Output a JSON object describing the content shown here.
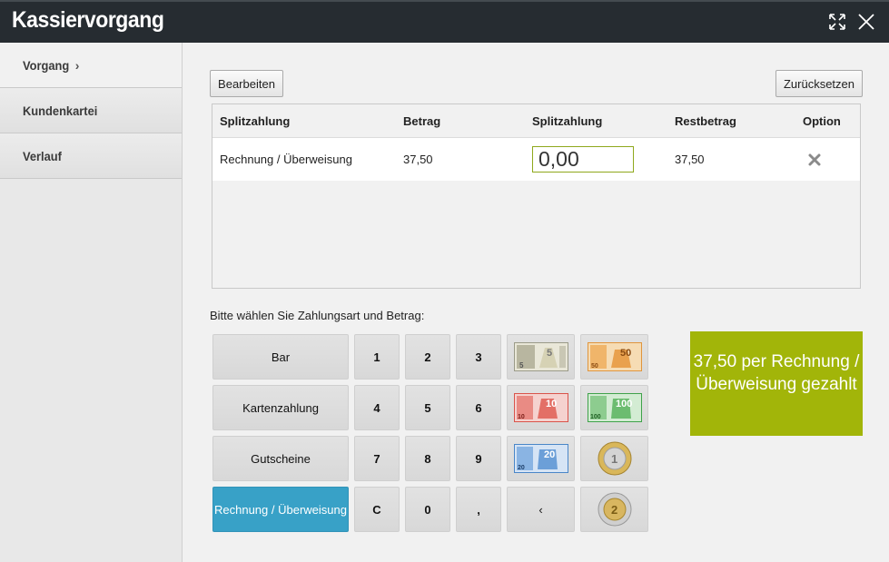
{
  "window": {
    "title": "Kassiervorgang"
  },
  "sidebar": {
    "items": [
      {
        "label": "Vorgang",
        "active": true,
        "chevron": "›"
      },
      {
        "label": "Kundenkartei",
        "active": false
      },
      {
        "label": "Verlauf",
        "active": false
      }
    ]
  },
  "toolbar": {
    "edit_label": "Bearbeiten",
    "reset_label": "Zurücksetzen"
  },
  "table": {
    "headers": [
      "Splitzahlung",
      "Betrag",
      "Splitzahlung",
      "Restbetrag",
      "Option"
    ],
    "rows": [
      {
        "method": "Rechnung / Überweisung",
        "amount": "37,50",
        "split_value": "0,00",
        "rest": "37,50",
        "option_icon": "close-x-icon"
      }
    ]
  },
  "instruction": "Bitte wählen Sie Zahlungsart und Betrag:",
  "payment_types": [
    "Bar",
    "Kartenzahlung",
    "Gutscheine",
    "Rechnung / Überweisung"
  ],
  "active_payment_type": "Rechnung / Überweisung",
  "keypad": [
    [
      "1",
      "2",
      "3"
    ],
    [
      "4",
      "5",
      "6"
    ],
    [
      "7",
      "8",
      "9"
    ],
    [
      "C",
      "0",
      ","
    ]
  ],
  "backspace_label": "‹",
  "money": [
    {
      "name": "banknote-5-euro",
      "value": "5",
      "color": "#9a9a88"
    },
    {
      "name": "banknote-50-euro",
      "value": "50",
      "color": "#e0953c"
    },
    {
      "name": "banknote-10-euro",
      "value": "10",
      "color": "#d9534a"
    },
    {
      "name": "banknote-100-euro",
      "value": "100",
      "color": "#3fa24a"
    },
    {
      "name": "banknote-20-euro",
      "value": "20",
      "color": "#4a86c8"
    },
    {
      "name": "coin-1-euro",
      "value": "1",
      "color": "#c9a64a"
    },
    {
      "name": "coin-2-euro",
      "value": "2",
      "color": "#b9b9b9"
    }
  ],
  "status_message": "37,50 per Rechnung / Überweisung gezahlt",
  "colors": {
    "accent_green": "#a2b509",
    "active_blue": "#38a1c7",
    "titlebar": "#262c31"
  }
}
